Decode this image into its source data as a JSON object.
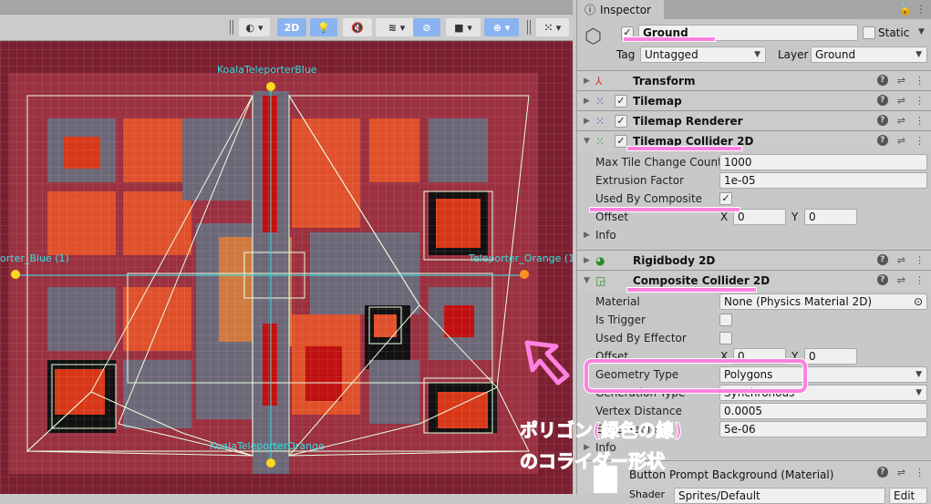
{
  "scene": {
    "toolbar": {
      "mode_2d": "2D",
      "icons": [
        "shading-mode-icon",
        "2d-toggle",
        "lighting-icon",
        "audio-mute-icon",
        "effects-icon",
        "hidden-objects-icon",
        "camera-icon",
        "gizmos-icon",
        "grid-snap-icon"
      ]
    },
    "labels": {
      "teleporter_blue_top": "KoalaTeleporterBlue",
      "teleporter_orange_bottom": "KoalaTeleporterOrange",
      "teleporter_blue_left": "orter_Blue (1)",
      "teleporter_orange_right": "Teleporter_Orange (1"
    },
    "colors": {
      "wall": "#8b2a3a",
      "floor_orange": "#e0502a",
      "floor_gray": "#6c6878",
      "polygon_line": "#e8ffe0"
    }
  },
  "inspector": {
    "tab": "Inspector",
    "object": {
      "name": "Ground",
      "active": true,
      "static_label": "Static",
      "static": false,
      "tag_label": "Tag",
      "tag": "Untagged",
      "layer_label": "Layer",
      "layer": "Ground"
    },
    "components": {
      "transform": "Transform",
      "tilemap": "Tilemap",
      "tilemap_renderer": "Tilemap Renderer",
      "tilemap_collider": {
        "title": "Tilemap Collider 2D",
        "max_tile_label": "Max Tile Change Count",
        "max_tile": "1000",
        "extrusion_label": "Extrusion Factor",
        "extrusion": "1e-05",
        "used_by_composite_label": "Used By Composite",
        "used_by_composite": true,
        "offset_label": "Offset",
        "x_label": "X",
        "x": "0",
        "y_label": "Y",
        "y": "0",
        "info": "Info"
      },
      "rigidbody": "Rigidbody 2D",
      "composite_collider": {
        "title": "Composite Collider 2D",
        "material_label": "Material",
        "material": "None (Physics Material 2D)",
        "is_trigger_label": "Is Trigger",
        "used_by_effector_label": "Used By Effector",
        "offset_label": "Offset",
        "x_label": "X",
        "x": "0",
        "y_label": "Y",
        "y": "0",
        "geometry_label": "Geometry Type",
        "geometry": "Polygons",
        "generation_label": "Generation Type",
        "generation": "Synchronous",
        "vertex_label": "Vertex Distance",
        "vertex": "0.0005",
        "edge_label": "Edge Radius",
        "edge": "5e-06",
        "info": "Info"
      },
      "material": {
        "title": "Button Prompt Background (Material)",
        "shader_label": "Shader",
        "shader": "Sprites/Default",
        "edit": "Edit"
      }
    }
  },
  "annotation": {
    "line1": "ポリゴン(緑色の線)",
    "line2": "のコライダー形状",
    "accent": "#ff80e0"
  }
}
